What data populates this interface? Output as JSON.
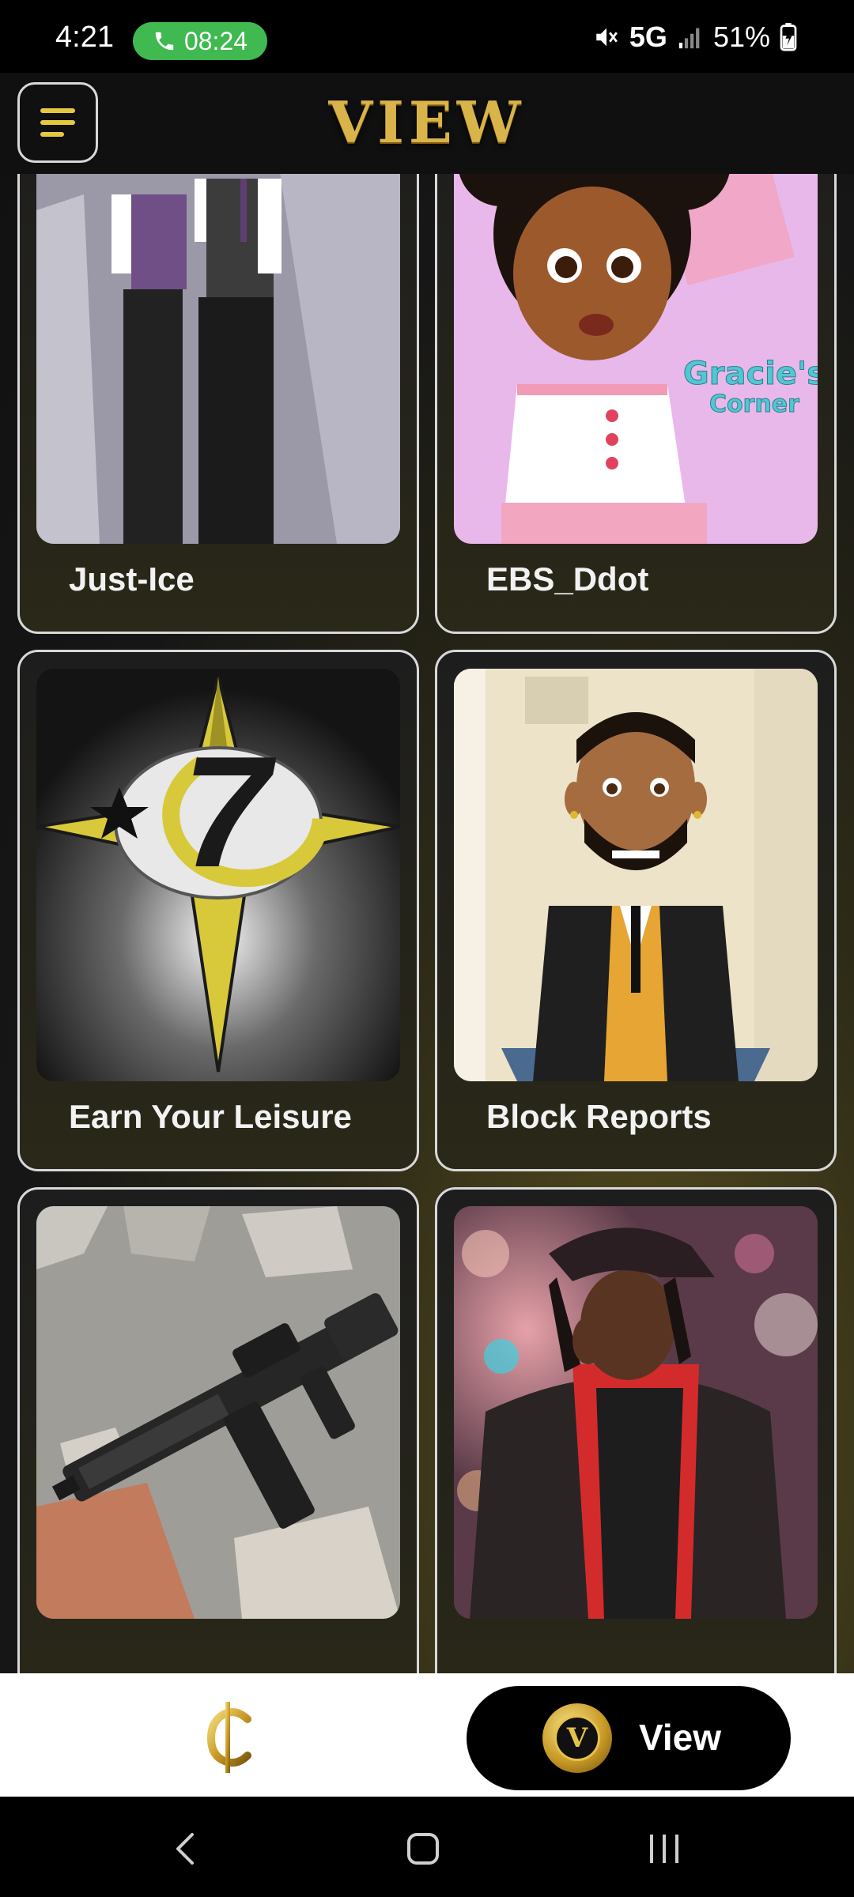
{
  "status_bar": {
    "time": "4:21",
    "call_timer": "08:24",
    "network": "5G",
    "battery": "51%"
  },
  "header": {
    "title": "VIEW"
  },
  "cards": [
    {
      "label": "Just-Ice",
      "image": "two men in vests illustration"
    },
    {
      "label": "EBS_Ddot",
      "image": "Gracie's Corner cartoon girl"
    },
    {
      "label": "Earn Your Leisure",
      "image": "gold star 7 logo"
    },
    {
      "label": "Block Reports",
      "image": "cartoon man in suit"
    },
    {
      "label": "",
      "image": "rifle on rocks"
    },
    {
      "label": "",
      "image": "person in red hoodie and cap"
    }
  ],
  "bottom_nav": {
    "home_icon": "cent-icon",
    "view_label": "View",
    "view_badge_letter": "V"
  },
  "system_nav": {
    "back": "back-icon",
    "home": "home-icon",
    "recents": "recents-icon"
  },
  "colors": {
    "gold": "#d9b44a",
    "call_green": "#3fb950"
  }
}
